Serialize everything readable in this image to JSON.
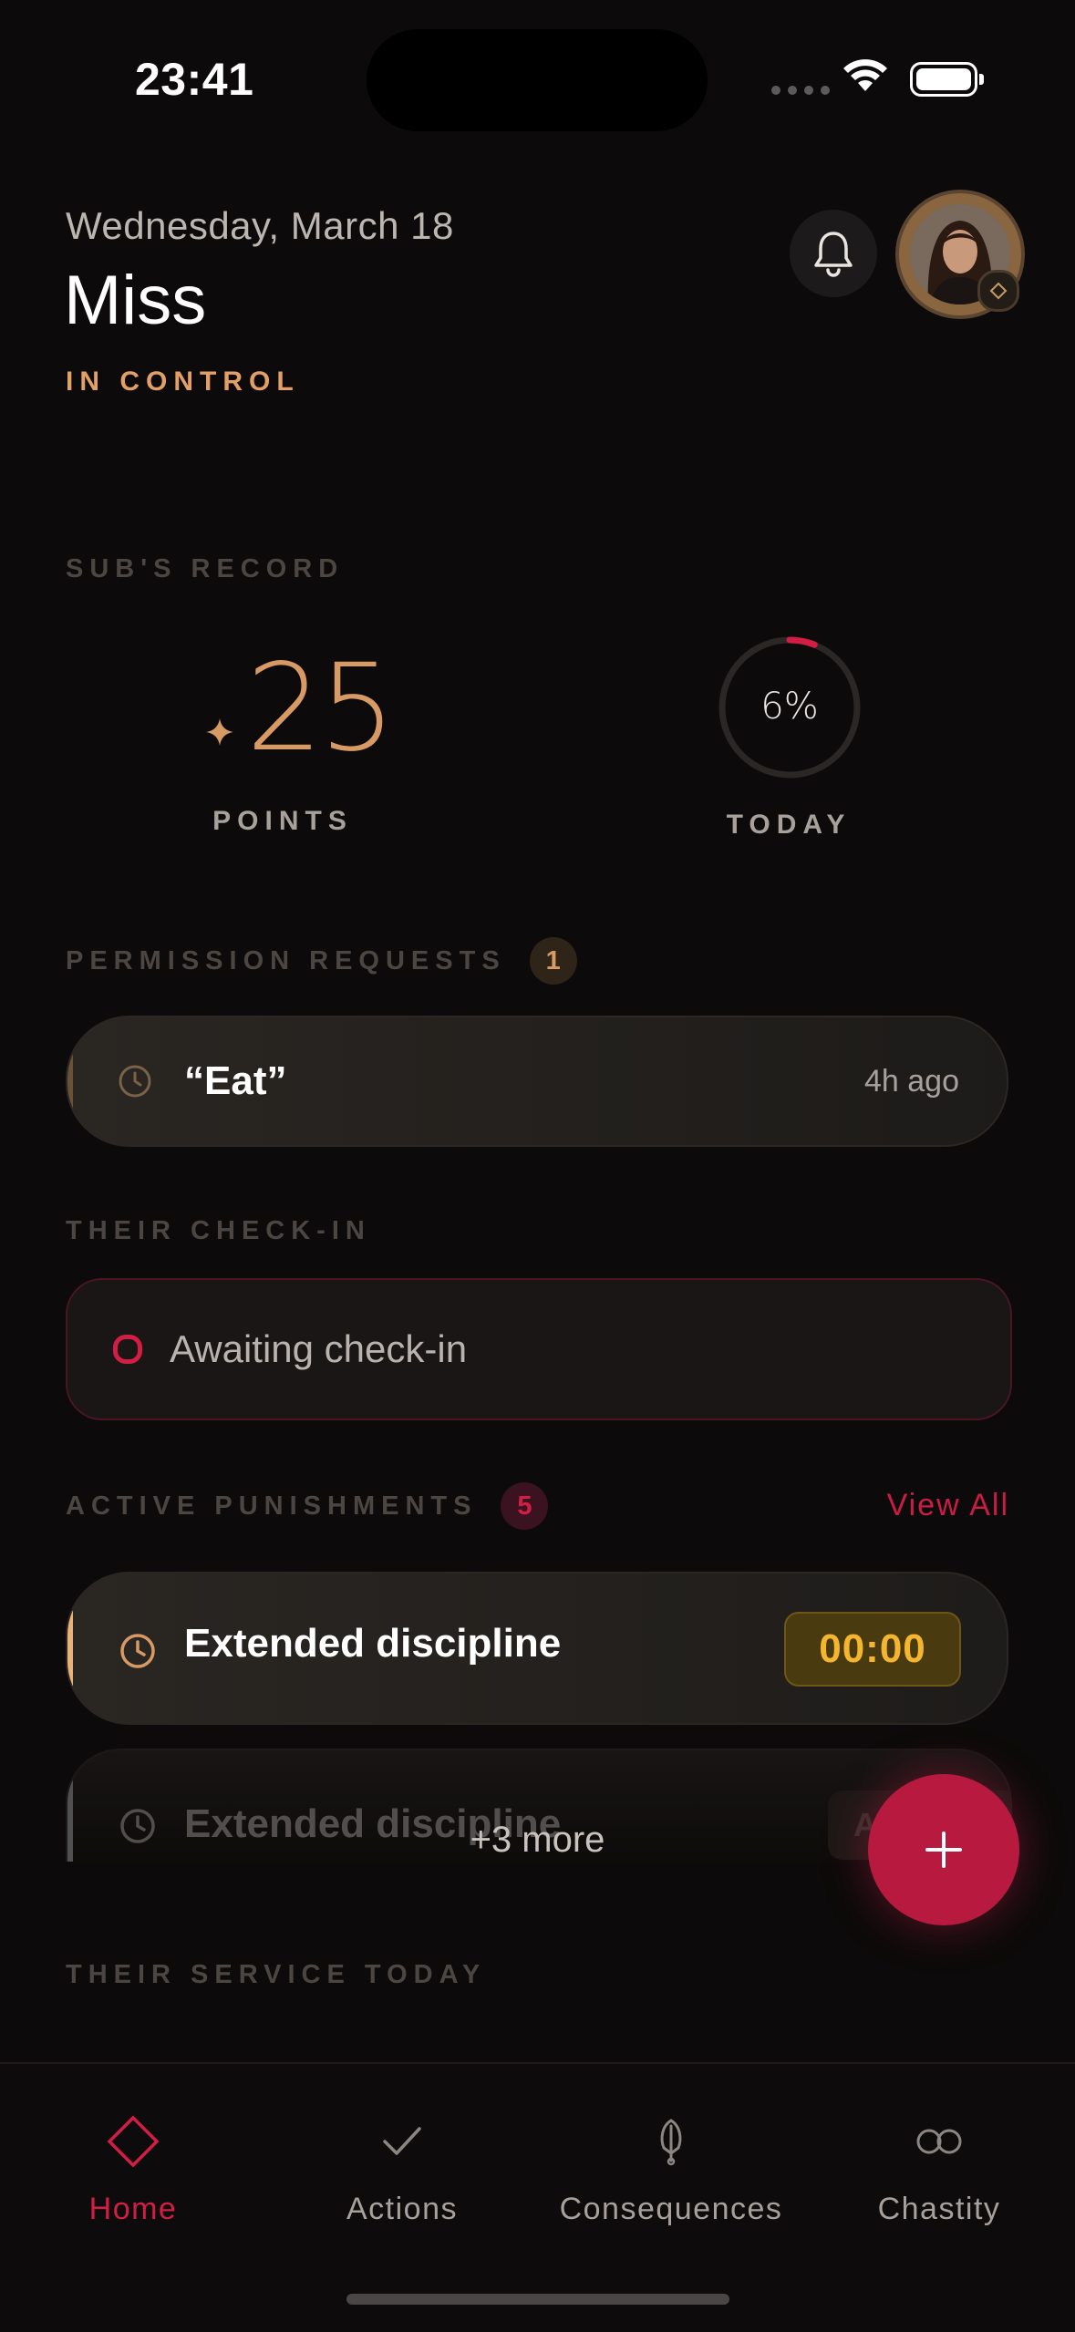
{
  "status_bar": {
    "time": "23:41"
  },
  "header": {
    "date": "Wednesday, March 18",
    "name": "Miss",
    "role": "IN CONTROL"
  },
  "record": {
    "section_title": "SUB'S RECORD",
    "points_value": "25",
    "points_label": "POINTS",
    "today_percent": "6%",
    "today_progress": 0.06,
    "today_label": "TODAY"
  },
  "permission_requests": {
    "section_title": "PERMISSION REQUESTS",
    "count": "1",
    "items": [
      {
        "title": "“Eat”",
        "time": "4h ago"
      }
    ]
  },
  "check_in": {
    "section_title": "THEIR CHECK-IN",
    "status": "Awaiting check-in"
  },
  "punishments": {
    "section_title": "ACTIVE PUNISHMENTS",
    "count": "5",
    "view_all": "View All",
    "items": [
      {
        "title": "Extended discipline",
        "timer": "00:00"
      },
      {
        "title": "Extended discipline",
        "action": "Assig"
      }
    ],
    "more": "+3 more"
  },
  "service": {
    "section_title": "THEIR SERVICE TODAY"
  },
  "fab": {
    "label": "+"
  },
  "tabs": [
    {
      "label": "Home",
      "icon": "diamond-icon",
      "active": true
    },
    {
      "label": "Actions",
      "icon": "check-icon",
      "active": false
    },
    {
      "label": "Consequences",
      "icon": "feather-icon",
      "active": false
    },
    {
      "label": "Chastity",
      "icon": "infinity-rings-icon",
      "active": false
    }
  ],
  "colors": {
    "background": "#0c0a0a",
    "accent_red": "#d21e45",
    "accent_gold": "#e2a066",
    "timer_yellow": "#f3b62e"
  }
}
